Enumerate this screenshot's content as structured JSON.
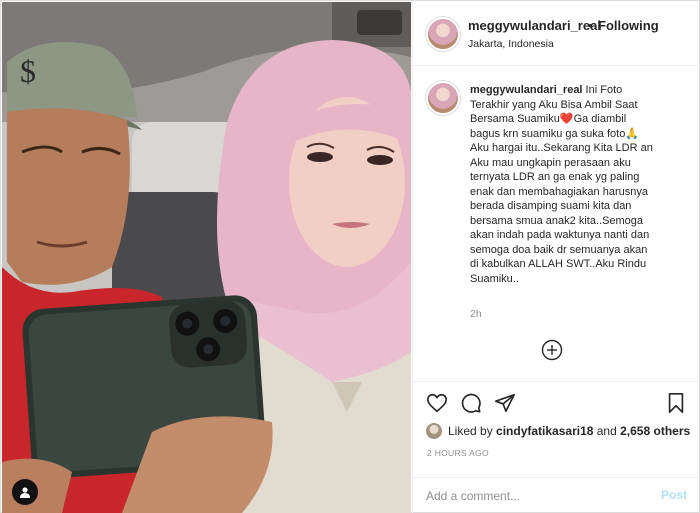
{
  "post": {
    "username": "meggywulandari_real",
    "follow_separator": "•",
    "follow_status": "Following",
    "location": "Jakarta, Indonesia"
  },
  "caption": {
    "username": "meggywulandari_real",
    "lines": [
      " Ini Foto",
      "Terakhir yang Aku Bisa Ambil Saat",
      "Bersama Suamiku❤️Ga diambil",
      "bagus krn suamiku ga suka foto🙏",
      "Aku hargai itu..Sekarang Kita LDR an",
      "Aku mau ungkapin perasaan aku",
      "ternyata LDR an ga enak yg paling",
      "enak dan membahagiakan harusnya",
      "berada disamping suami kita dan",
      "bersama smua anak2 kita..Semoga",
      "akan indah pada waktunya nanti dan",
      "semoga doa baik dr semuanya akan",
      "di kabulkan ALLAH SWT..Aku Rindu",
      "Suamiku.."
    ],
    "time_ago": "2h"
  },
  "likes": {
    "prefix": "Liked by ",
    "liker": "cindyfatikasari18",
    "middle": " and ",
    "others": "2,658 others"
  },
  "post_date": "2 HOURS AGO",
  "comment": {
    "placeholder": "Add a comment...",
    "post_label": "Post"
  },
  "icons": {
    "heart": "heart-icon",
    "comment": "comment-icon",
    "share": "share-icon",
    "save": "bookmark-icon",
    "user_tag": "user-tag-icon",
    "load_more": "plus-circle-icon"
  },
  "colors": {
    "text": "#262626",
    "secondary": "#8e8e8e",
    "border": "#dbdbdb",
    "post_disabled": "#b2dffc"
  }
}
